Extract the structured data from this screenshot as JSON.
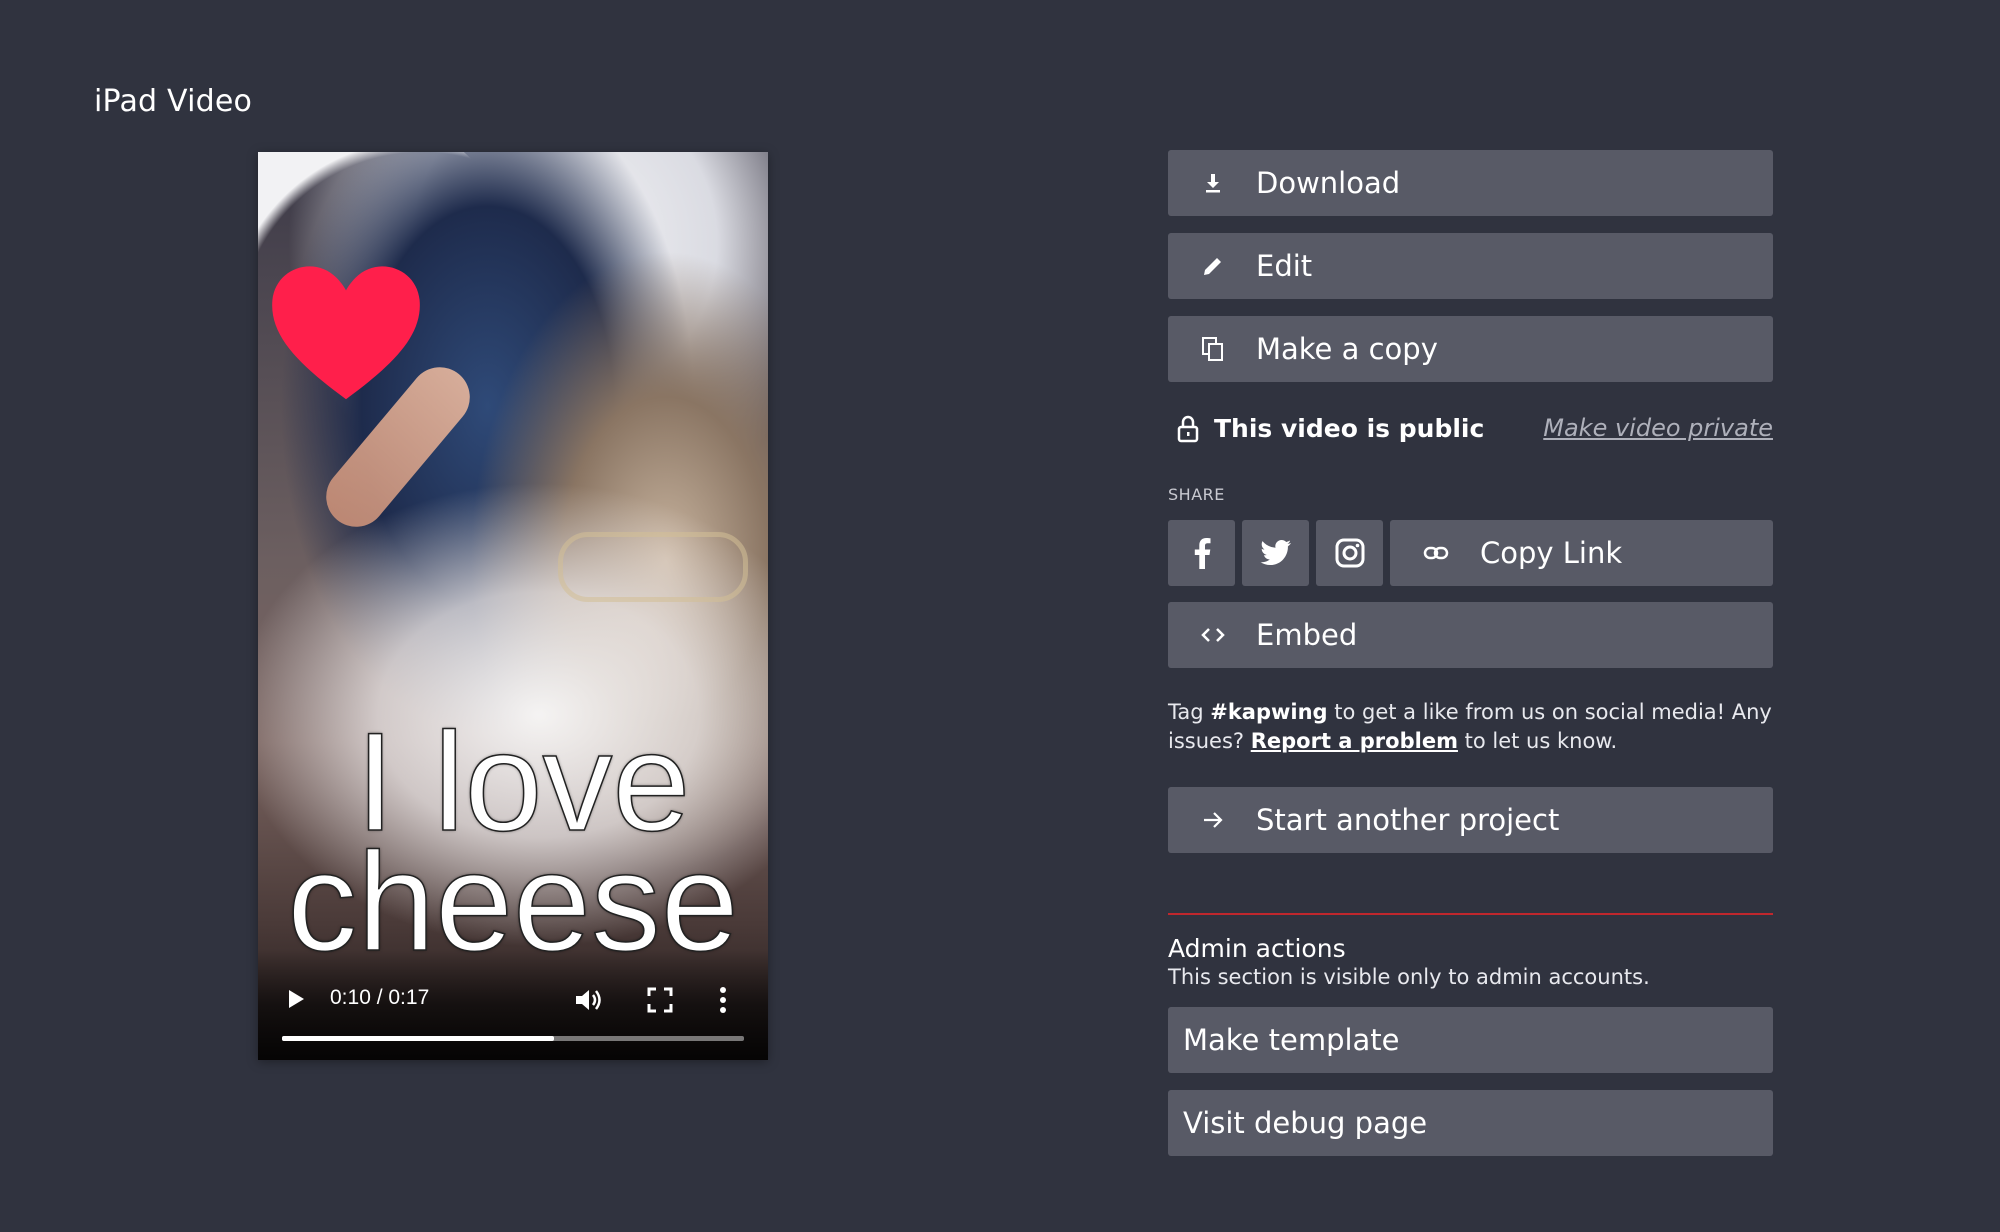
{
  "page": {
    "title": "iPad Video"
  },
  "video": {
    "caption_line1": "I love",
    "caption_line2": "cheese",
    "time_display": "0:10 / 0:17",
    "progress_fraction": 0.588
  },
  "actions": {
    "download_label": "Download",
    "edit_label": "Edit",
    "copy_label": "Make a copy"
  },
  "visibility": {
    "status_text": "This video is public",
    "toggle_link": "Make video private"
  },
  "share": {
    "heading": "SHARE",
    "facebook_icon": "facebook-icon",
    "twitter_icon": "twitter-icon",
    "instagram_icon": "instagram-icon",
    "copy_link_label": "Copy Link",
    "embed_label": "Embed"
  },
  "tag_message": {
    "prefix": "Tag ",
    "hashtag": "#kapwing",
    "middle": " to get a like from us on social media! Any issues? ",
    "link_text": "Report a problem",
    "suffix": " to let us know."
  },
  "start_project_label": "Start another project",
  "admin": {
    "title": "Admin actions",
    "subtitle": "This section is visible only to admin accounts.",
    "make_template_label": "Make template",
    "debug_label": "Visit debug page"
  },
  "colors": {
    "background": "#30333f",
    "button": "#585a66",
    "divider": "#c0272d",
    "heart": "#ff1f4b"
  }
}
